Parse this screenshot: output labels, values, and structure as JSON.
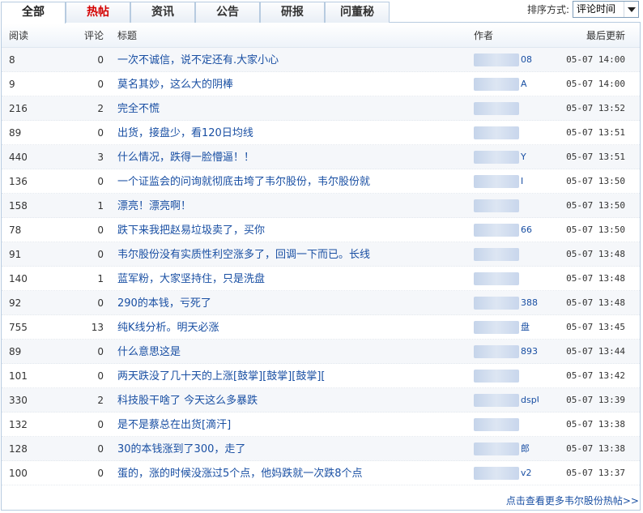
{
  "tabs": [
    {
      "label": "全部",
      "active": true
    },
    {
      "label": "热帖",
      "hot": true
    },
    {
      "label": "资讯"
    },
    {
      "label": "公告"
    },
    {
      "label": "研报"
    },
    {
      "label": "问董秘"
    }
  ],
  "sort": {
    "label": "排序方式:",
    "selected": "评论时间"
  },
  "columns": {
    "read": "阅读",
    "comments": "评论",
    "title": "标题",
    "author": "作者",
    "updated": "最后更新"
  },
  "rows": [
    {
      "read": "8",
      "comments": "0",
      "title": "一次不诚信，说不定还有.大家小心",
      "author": "08",
      "time": "05-07 14:00"
    },
    {
      "read": "9",
      "comments": "0",
      "title": "莫名其妙，这么大的阴棒",
      "author": "A",
      "time": "05-07 14:00"
    },
    {
      "read": "216",
      "comments": "2",
      "title": "完全不慌",
      "author": "",
      "time": "05-07 13:52"
    },
    {
      "read": "89",
      "comments": "0",
      "title": "出货，接盘少，看120日均线",
      "author": "",
      "time": "05-07 13:51"
    },
    {
      "read": "440",
      "comments": "3",
      "title": "什么情况，跌得一脸懵逼！！",
      "author": "Y",
      "time": "05-07 13:51"
    },
    {
      "read": "136",
      "comments": "0",
      "title": "一个证监会的问询就彻底击垮了韦尔股份，韦尔股份就",
      "author": "I",
      "time": "05-07 13:50"
    },
    {
      "read": "158",
      "comments": "1",
      "title": "漂亮！漂亮啊！",
      "author": "",
      "time": "05-07 13:50"
    },
    {
      "read": "78",
      "comments": "0",
      "title": "跌下来我把赵易垃圾卖了，买你",
      "author": "66",
      "time": "05-07 13:50"
    },
    {
      "read": "91",
      "comments": "0",
      "title": "韦尔股份没有实质性利空涨多了，回调一下而已。长线",
      "author": "",
      "time": "05-07 13:48"
    },
    {
      "read": "140",
      "comments": "1",
      "title": "蓝军粉，大家坚持住，只是洗盘",
      "author": "",
      "time": "05-07 13:48"
    },
    {
      "read": "92",
      "comments": "0",
      "title": "290的本钱，亏死了",
      "author": "388",
      "time": "05-07 13:48"
    },
    {
      "read": "755",
      "comments": "13",
      "title": "纯K线分析。明天必涨",
      "author": "盘",
      "time": "05-07 13:45"
    },
    {
      "read": "89",
      "comments": "0",
      "title": "什么意思这是",
      "author": "893...",
      "time": "05-07 13:44"
    },
    {
      "read": "101",
      "comments": "0",
      "title": "两天跌没了几十天的上涨[鼓掌][鼓掌][鼓掌][",
      "author": "",
      "time": "05-07 13:42"
    },
    {
      "read": "330",
      "comments": "2",
      "title": "科技股干啥了 今天这么多暴跌",
      "author": "dspU",
      "time": "05-07 13:39"
    },
    {
      "read": "132",
      "comments": "0",
      "title": "是不是蔡总在出货[滴汗]",
      "author": "",
      "time": "05-07 13:38"
    },
    {
      "read": "128",
      "comments": "0",
      "title": "30的本钱涨到了300，走了",
      "author": "郎",
      "time": "05-07 13:38"
    },
    {
      "read": "100",
      "comments": "0",
      "title": "蛋的，涨的时候没涨过5个点，他妈跌就一次跌8个点",
      "author": "v2",
      "time": "05-07 13:37"
    }
  ],
  "more_link": "点击查看更多韦尔股份热帖>>"
}
